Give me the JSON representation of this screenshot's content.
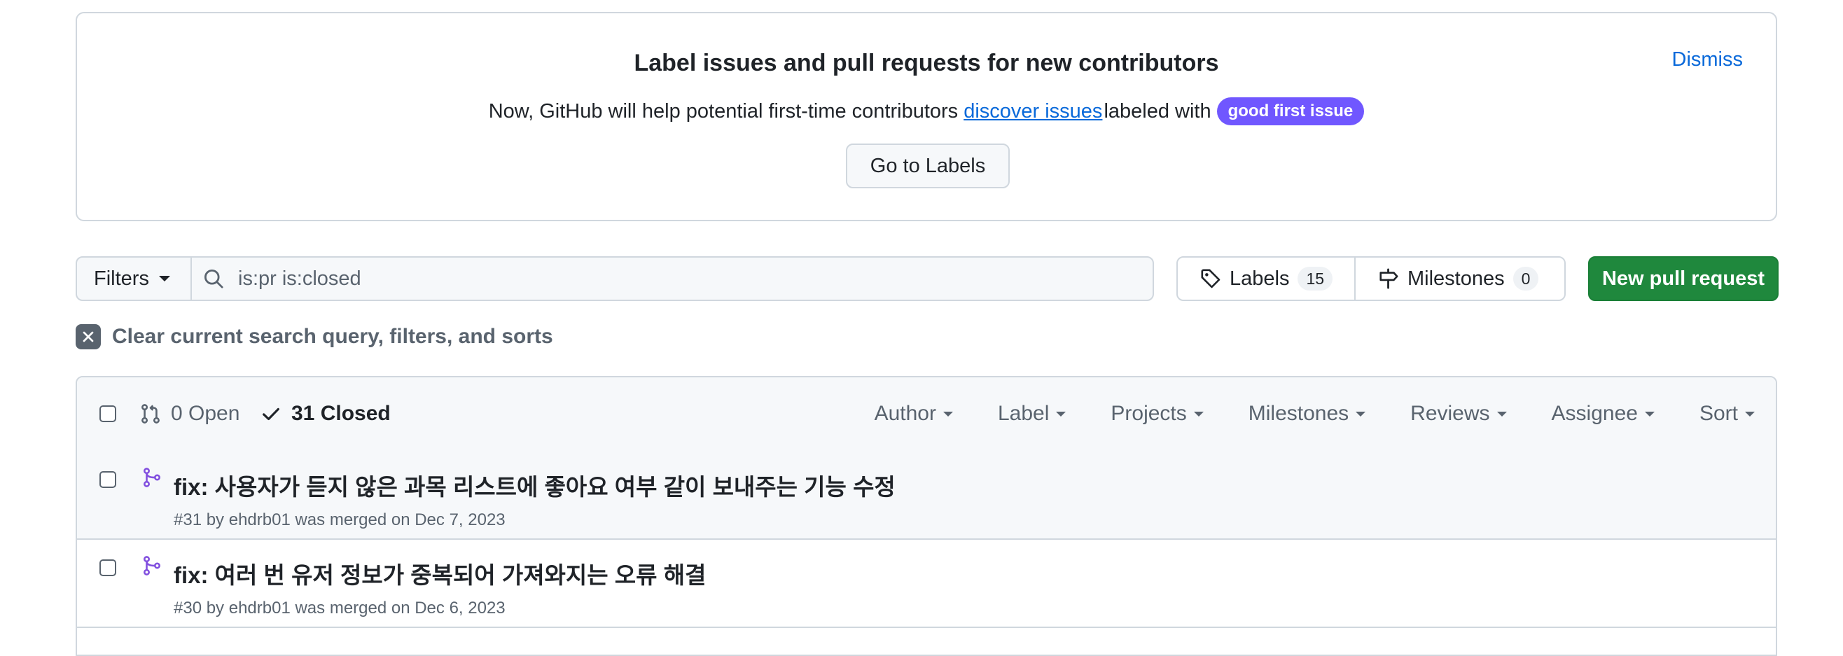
{
  "banner": {
    "title": "Label issues and pull requests for new contributors",
    "desc_prefix": "Now, GitHub will help potential first-time contributors",
    "desc_link": "discover issues",
    "desc_suffix": "labeled with",
    "label_badge": "good first issue",
    "go_button": "Go to Labels",
    "dismiss": "Dismiss"
  },
  "toolbar": {
    "filters_label": "Filters",
    "search_value": "is:pr is:closed",
    "labels_label": "Labels",
    "labels_count": "15",
    "milestones_label": "Milestones",
    "milestones_count": "0",
    "new_pr_label": "New pull request"
  },
  "clear_filters": "Clear current search query, filters, and sorts",
  "list_header": {
    "open_label": "0 Open",
    "closed_label": "31 Closed",
    "menus": [
      "Author",
      "Label",
      "Projects",
      "Milestones",
      "Reviews",
      "Assignee",
      "Sort"
    ]
  },
  "pull_requests": [
    {
      "title": "fix: 사용자가 듣지 않은 과목 리스트에 좋아요 여부 같이 보내주는 기능 수정",
      "meta": "#31 by ehdrb01 was merged on Dec 7, 2023"
    },
    {
      "title": "fix: 여러 번 유저 정보가 중복되어 가져와지는 오류 해결",
      "meta": "#30 by ehdrb01 was merged on Dec 6, 2023"
    }
  ],
  "colors": {
    "accent": "#0969da",
    "primary_button": "#1f883d",
    "label_badge": "#7057ff",
    "merged_icon": "#8250df"
  }
}
